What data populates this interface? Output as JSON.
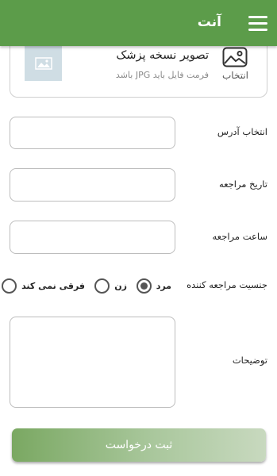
{
  "app": {
    "title": "آنت",
    "accent_color": "#5c9c4a",
    "menu_icon": "hamburger-menu-icon"
  },
  "upload": {
    "title": "تصویر نسخه پزشک",
    "hint": "فرمت فایل باید JPG باشد",
    "pick_label": "انتخاب",
    "pick_icon": "image-icon",
    "preview_icon": "image-placeholder-icon"
  },
  "form": {
    "address_label": "انتخاب آدرس",
    "address_value": "",
    "date_label": "تاریخ مراجعه",
    "date_value": "",
    "time_label": "ساعت مراجعه",
    "time_value": "",
    "gender_label": "جنسیت مراجعه کننده",
    "gender_options": [
      {
        "label": "مرد",
        "checked": true
      },
      {
        "label": "زن",
        "checked": false
      },
      {
        "label": "فرقی نمی کند",
        "checked": false
      }
    ],
    "notes_label": "توضیحات",
    "notes_value": ""
  },
  "submit_label": "ثبت درخواست"
}
